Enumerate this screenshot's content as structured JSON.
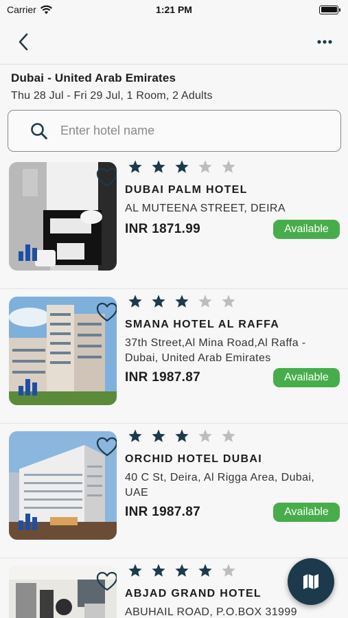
{
  "status": {
    "carrier": "Carrier",
    "time": "1:21 PM"
  },
  "nav": {
    "back_icon": "chevron-left-icon",
    "more_icon": "ellipsis-icon"
  },
  "header": {
    "city": "Dubai - United Arab Emirates",
    "dates": "Thu 28 Jul - Fri 29 Jul, 1 Room, 2 Adults"
  },
  "search": {
    "placeholder": "Enter hotel name",
    "value": ""
  },
  "colors": {
    "accent": "#1d3a4c",
    "available": "#47ad4a",
    "star_on": "#1d3a4c",
    "star_off": "#bdbdbd"
  },
  "hotels": [
    {
      "name": "DUBAI PALM HOTEL",
      "address": "AL MUTEENA STREET, DEIRA",
      "price": "INR 1871.99",
      "availability": "Available",
      "stars": 3
    },
    {
      "name": "SMANA HOTEL AL RAFFA",
      "address": "37th Street,Al Mina Road,Al Raffa - Dubai, United Arab Emirates",
      "price": "INR 1987.87",
      "availability": "Available",
      "stars": 3
    },
    {
      "name": "ORCHID HOTEL DUBAI",
      "address": "40 C St, Deira, Al Rigga Area, Dubai, UAE",
      "price": "INR 1987.87",
      "availability": "Available",
      "stars": 3
    },
    {
      "name": "ABJAD GRAND HOTEL",
      "address": "ABUHAIL ROAD, P.O.BOX 31999",
      "price": "",
      "availability": "",
      "stars": 4
    }
  ],
  "fab": {
    "icon": "map-icon"
  }
}
